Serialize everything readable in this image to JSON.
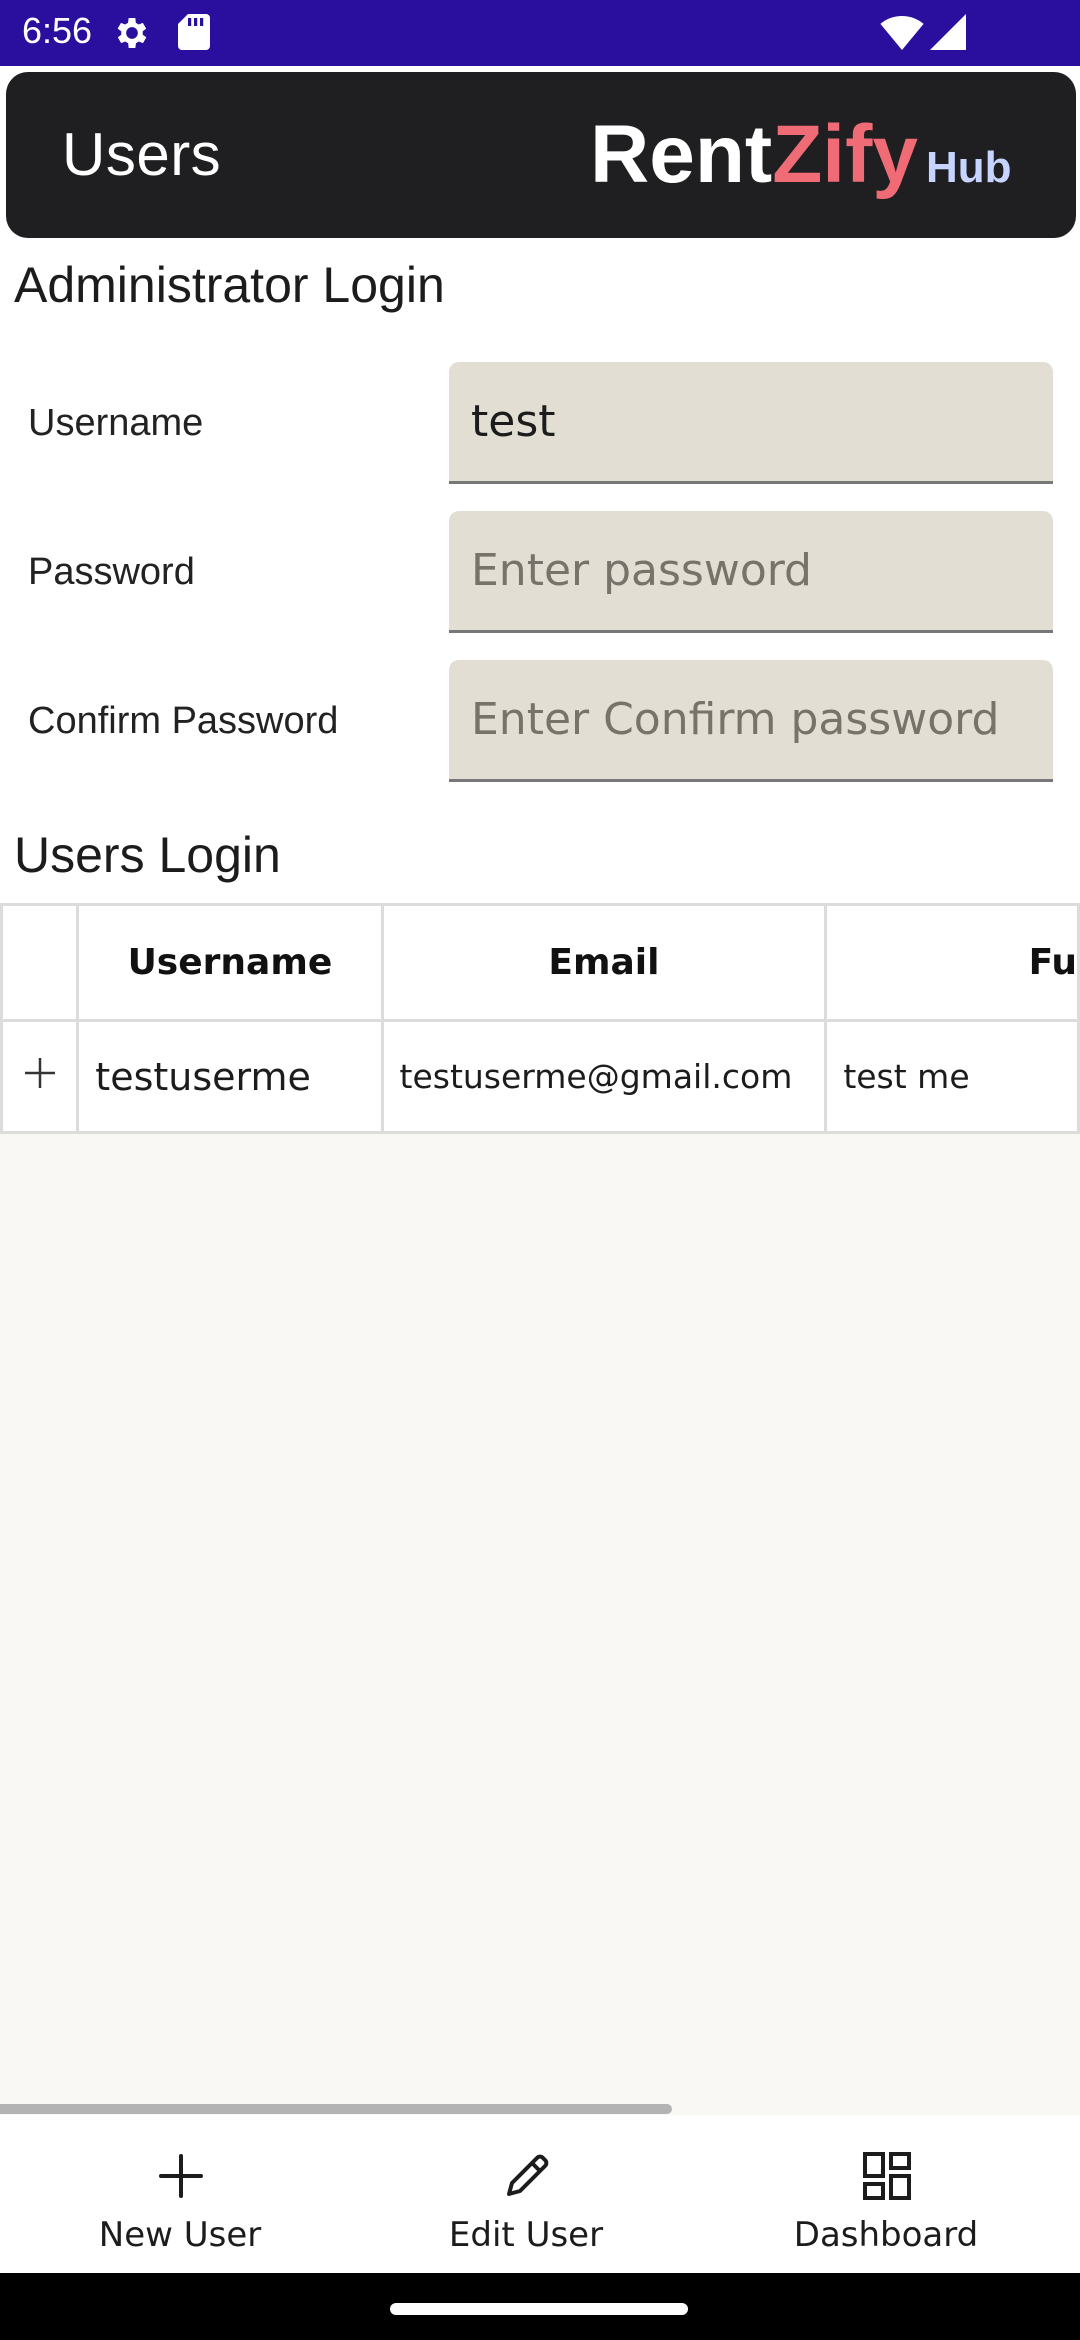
{
  "status_bar": {
    "time": "6:56",
    "icons": [
      "settings-gear-icon",
      "sd-card-icon",
      "wifi-icon",
      "cell-signal-icon"
    ]
  },
  "header": {
    "title": "Users",
    "brand": {
      "part1": "Rent",
      "part2": "Zify",
      "part3": "Hub"
    },
    "colors": {
      "background": "#1f1f21",
      "brand_accent": "#ef6b76",
      "hub": "#c6d4ff"
    }
  },
  "admin_login": {
    "title": "Administrator Login",
    "fields": [
      {
        "label": "Username",
        "value": "test",
        "placeholder": ""
      },
      {
        "label": "Password",
        "value": "",
        "placeholder": "Enter password"
      },
      {
        "label": "Confirm Password",
        "value": "",
        "placeholder": "Enter Confirm password"
      }
    ]
  },
  "users_login": {
    "title": "Users Login",
    "columns": [
      "",
      "Username",
      "Email",
      "Fu"
    ],
    "rows": [
      {
        "expand": "+",
        "username": "testuserme",
        "email": "testuserme@gmail.com",
        "full_name": "test me"
      }
    ]
  },
  "bottom_nav": {
    "items": [
      {
        "label": "New User",
        "icon": "plus-icon"
      },
      {
        "label": "Edit User",
        "icon": "pencil-icon"
      },
      {
        "label": "Dashboard",
        "icon": "dashboard-grid-icon"
      }
    ]
  },
  "colors": {
    "status_bar": "#2a0e9e",
    "input_background": "#e2ded3",
    "page_background": "#f9f8f5"
  }
}
